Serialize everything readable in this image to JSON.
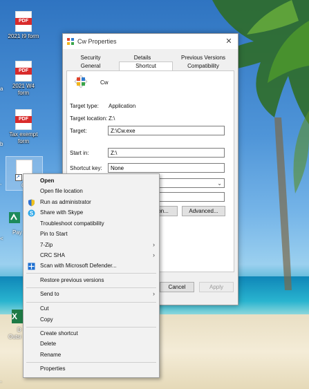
{
  "desktop": {
    "icons": [
      {
        "label_lines": [
          "2021 I9 form"
        ],
        "badge": "PDF"
      },
      {
        "label_lines": [
          "2021 W4",
          "form"
        ],
        "badge": "PDF"
      },
      {
        "label_lines": [
          "Tax exempt",
          "form"
        ],
        "badge": "PDF"
      }
    ],
    "partials": {
      "c": "C",
      "pay": "Pay",
      "da": "D",
      "outs": "Outsi",
      "excel_badge": "X",
      "left_a": "a",
      "left_b": "b",
      "left_dot": ",",
      "left_lt": "<",
      "left_dash": "-"
    }
  },
  "dialog": {
    "title": "Cw Properties",
    "close_glyph": "✕",
    "tabs_row1": [
      "Security",
      "Details",
      "Previous Versions"
    ],
    "tabs_row2": [
      "General",
      "Shortcut",
      "Compatibility"
    ],
    "active_tab": "Shortcut",
    "app_name": "Cw",
    "target_type_label": "Target type:",
    "target_type_value": "Application",
    "target_location_label": "Target location:",
    "target_location_value": "Z:\\",
    "target_label": "Target:",
    "target_value": "Z:\\Cw.exe",
    "start_in_label": "Start in:",
    "start_in_value": "Z:\\",
    "shortcut_key_label": "Shortcut key:",
    "shortcut_key_value": "None",
    "icon_button": "Icon...",
    "advanced_button": "Advanced...",
    "cancel_button": "Cancel",
    "apply_button": "Apply"
  },
  "context_menu": {
    "items": {
      "open": "Open",
      "open_location": "Open file location",
      "run_admin": "Run as administrator",
      "share_skype": "Share with Skype",
      "troubleshoot": "Troubleshoot compatibility",
      "pin_start": "Pin to Start",
      "zip": "7-Zip",
      "crc": "CRC SHA",
      "defender": "Scan with Microsoft Defender...",
      "restore": "Restore previous versions",
      "send_to": "Send to",
      "cut": "Cut",
      "copy": "Copy",
      "create_shortcut": "Create shortcut",
      "delete": "Delete",
      "rename": "Rename",
      "properties": "Properties"
    },
    "submenu_arrow": "›"
  },
  "colors": {
    "pdf_red": "#d92b2b",
    "excel_green": "#1d7a45",
    "uac_blue": "#2f6fd0",
    "skype_blue": "#2aa6e8"
  }
}
